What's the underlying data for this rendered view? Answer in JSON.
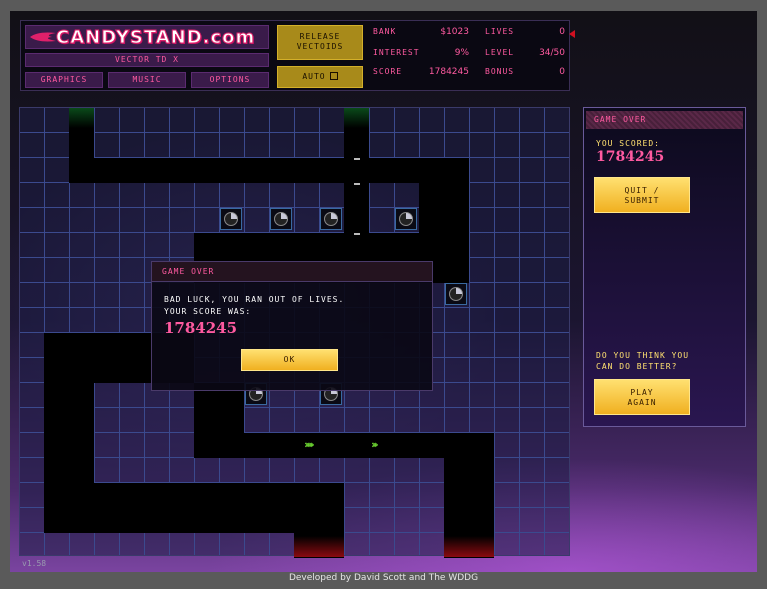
{
  "header": {
    "logo_text": "CANDYSTAND.com",
    "subtitle": "VECTOR TD X",
    "nav": {
      "graphics": "GRAPHICS",
      "music": "MUSIC",
      "options": "OPTIONS"
    },
    "release_label": "RELEASE\nVECTOIDS",
    "auto_label": "AUTO"
  },
  "stats": {
    "bank_label": "BANK",
    "bank_value": "$1023",
    "interest_label": "INTEREST",
    "interest_value": "9%",
    "score_label": "SCORE",
    "score_value": "1784245",
    "lives_label": "LIVES",
    "lives_value": "0",
    "level_label": "LEVEL",
    "level_value": "34/50",
    "bonus_label": "BONUS",
    "bonus_value": "0"
  },
  "dialog": {
    "title": "GAME OVER",
    "message_line1": "BAD LUCK, YOU RAN OUT OF LIVES.",
    "message_line2": "YOUR SCORE WAS:",
    "score": "1784245",
    "ok_label": "OK"
  },
  "panel": {
    "title": "GAME OVER",
    "scored_label": "YOU SCORED:",
    "score": "1784245",
    "quit_label": "QUIT /\nSUBMIT",
    "question": "DO YOU THINK YOU\nCAN DO BETTER?",
    "play_again_label": "PLAY\nAGAIN"
  },
  "footer": {
    "version": "v1.58",
    "credits": "Developed by David Scott and The WDDG"
  },
  "colors": {
    "accent_pink": "#ff5aa0",
    "button_yellow": "#f0b020",
    "grid_blue": "#3b4a8e",
    "creep_green": "#6ad030"
  },
  "icons": {
    "tower": "pie-tower-icon",
    "creep": "chevron-creep-icon",
    "lives_indicator": "red-arrow-icon"
  }
}
